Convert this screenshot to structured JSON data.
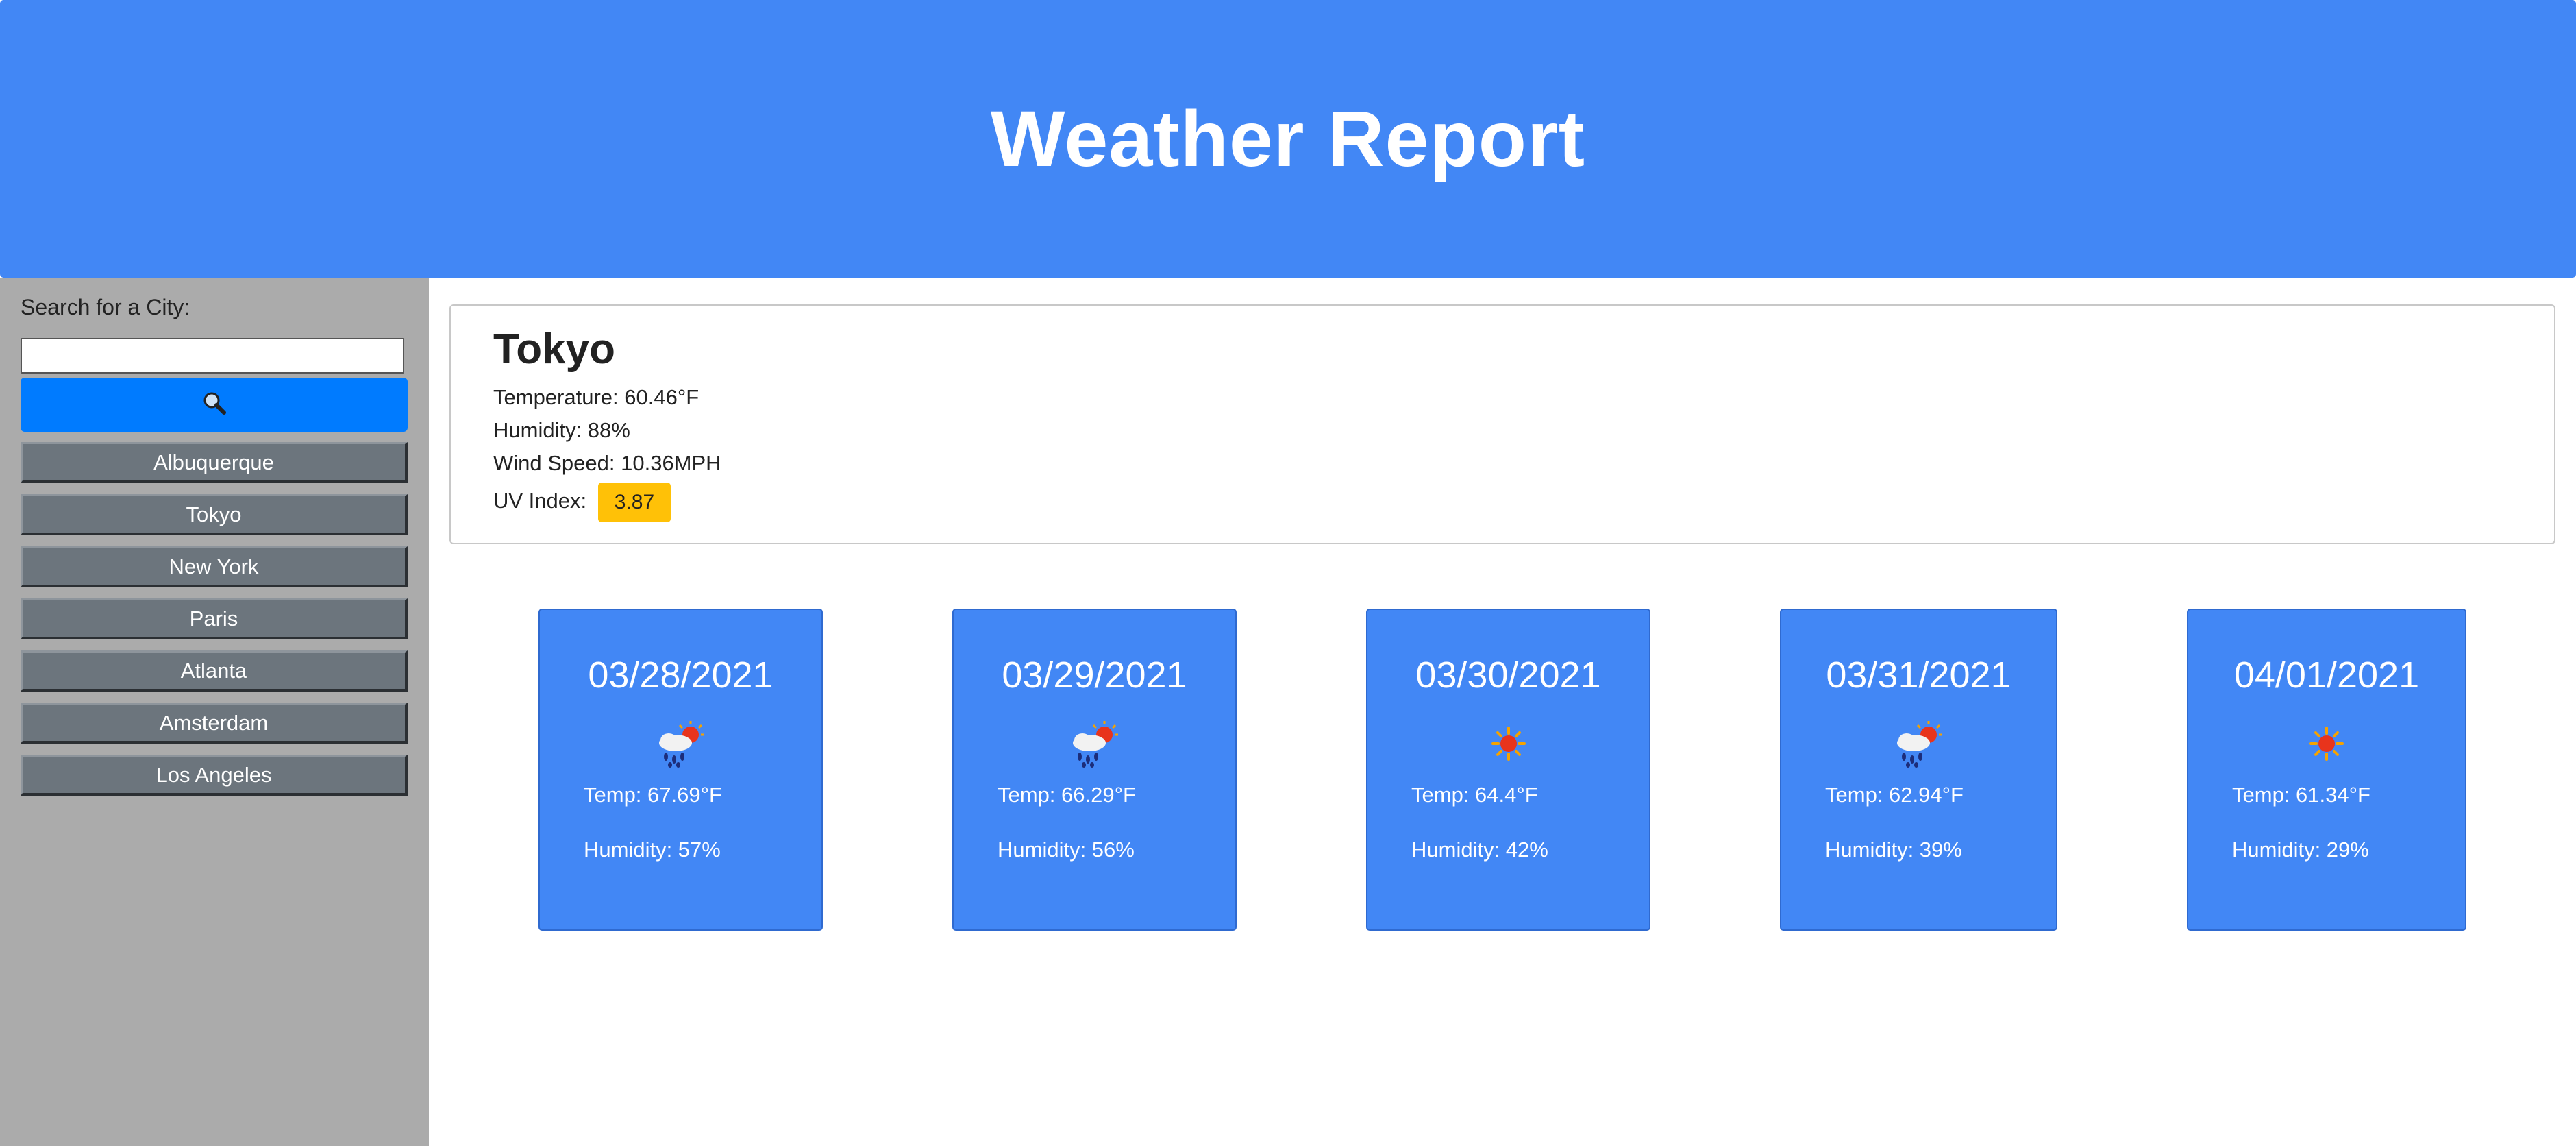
{
  "header": {
    "title": "Weather Report"
  },
  "sidebar": {
    "search_label": "Search for a City:",
    "search_value": "",
    "search_icon": "search-icon",
    "cities": [
      "Albuquerque",
      "Tokyo",
      "New York",
      "Paris",
      "Atlanta",
      "Amsterdam",
      "Los Angeles"
    ]
  },
  "current": {
    "city": "Tokyo",
    "temperature": "Temperature: 60.46°F",
    "humidity": "Humidity: 88%",
    "wind": "Wind Speed: 10.36MPH",
    "uv_label": "UV Index:",
    "uv_value": "3.87",
    "uv_color": "#ffc107"
  },
  "forecast": [
    {
      "date": "03/28/2021",
      "icon": "rain-sun-icon",
      "temp": "Temp: 67.69°F",
      "humidity": "Humidity: 57%"
    },
    {
      "date": "03/29/2021",
      "icon": "rain-sun-icon",
      "temp": "Temp: 66.29°F",
      "humidity": "Humidity: 56%"
    },
    {
      "date": "03/30/2021",
      "icon": "sun-icon",
      "temp": "Temp: 64.4°F",
      "humidity": "Humidity: 42%"
    },
    {
      "date": "03/31/2021",
      "icon": "rain-sun-icon",
      "temp": "Temp: 62.94°F",
      "humidity": "Humidity: 39%"
    },
    {
      "date": "04/01/2021",
      "icon": "sun-icon",
      "temp": "Temp: 61.34°F",
      "humidity": "Humidity: 29%"
    }
  ],
  "colors": {
    "header": "#4287f5",
    "sidebar": "#ababab",
    "search_button": "#007bff",
    "city_button": "#6c757d",
    "card": "#4287f5"
  }
}
